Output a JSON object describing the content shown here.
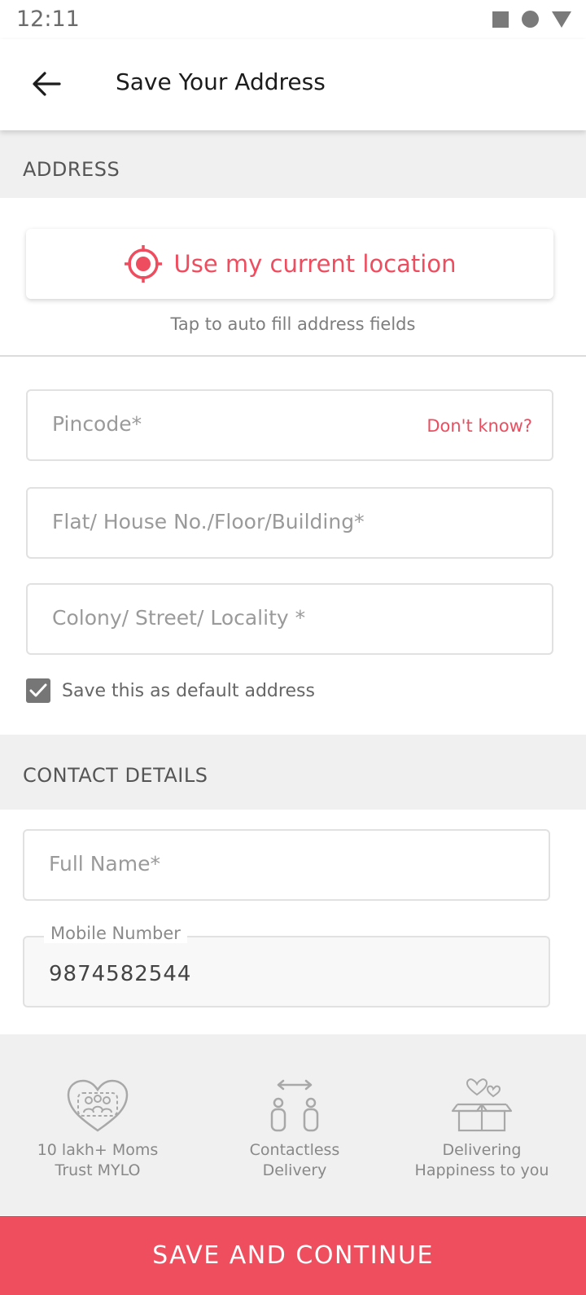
{
  "status_bar": {
    "time": "12:11"
  },
  "header": {
    "title": "Save Your Address"
  },
  "address_section": {
    "title": "ADDRESS",
    "use_location_label": "Use my current location",
    "use_location_hint": "Tap to auto fill address fields",
    "pincode": {
      "placeholder": "Pincode*",
      "helper_link": "Don't know?"
    },
    "flat": {
      "placeholder": "Flat/ House No./Floor/Building*"
    },
    "colony": {
      "placeholder": "Colony/ Street/ Locality *"
    },
    "default_checkbox": {
      "label": "Save this as default address",
      "checked": true
    }
  },
  "contact_section": {
    "title": "CONTACT DETAILS",
    "full_name": {
      "placeholder": "Full Name*"
    },
    "mobile": {
      "label": "Mobile Number",
      "value": "9874582544"
    }
  },
  "trust_badges": [
    {
      "icon": "heart-family-icon",
      "line1": "10 lakh+ Moms",
      "line2": "Trust MYLO"
    },
    {
      "icon": "contactless-delivery-icon",
      "line1": "Contactless",
      "line2": "Delivery"
    },
    {
      "icon": "gift-box-hearts-icon",
      "line1": "Delivering",
      "line2": "Happiness to you"
    }
  ],
  "cta": {
    "label": "SAVE AND CONTINUE"
  },
  "colors": {
    "accent": "#ee4d5f",
    "cta_bg": "#ef4e5f",
    "section_bg": "#f0f0f0"
  }
}
